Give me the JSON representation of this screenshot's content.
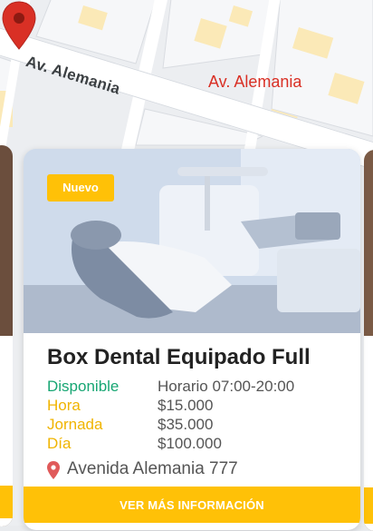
{
  "map": {
    "street_label": "Av. Alemania",
    "pin_label": "Av. Alemania",
    "colors": {
      "pin": "#d93025",
      "road": "#ffffff",
      "block": "#fbe9b7"
    }
  },
  "card": {
    "badge": "Nuevo",
    "title": "Box Dental Equipado Full",
    "status_label": "Disponible",
    "schedule": "Horario 07:00-20:00",
    "prices": [
      {
        "label": "Hora",
        "value": "$15.000"
      },
      {
        "label": "Jornada",
        "value": "$35.000"
      },
      {
        "label": "Día",
        "value": "$100.000"
      }
    ],
    "address": "Avenida Alemania 777",
    "cta_label": "VER MÁS INFORMACIÓN",
    "icons": {
      "address": "location-pin-icon",
      "map": "map-pin-icon"
    },
    "colors": {
      "accent": "#ffc107",
      "available": "#17a673",
      "price_label": "#f0b400"
    }
  }
}
